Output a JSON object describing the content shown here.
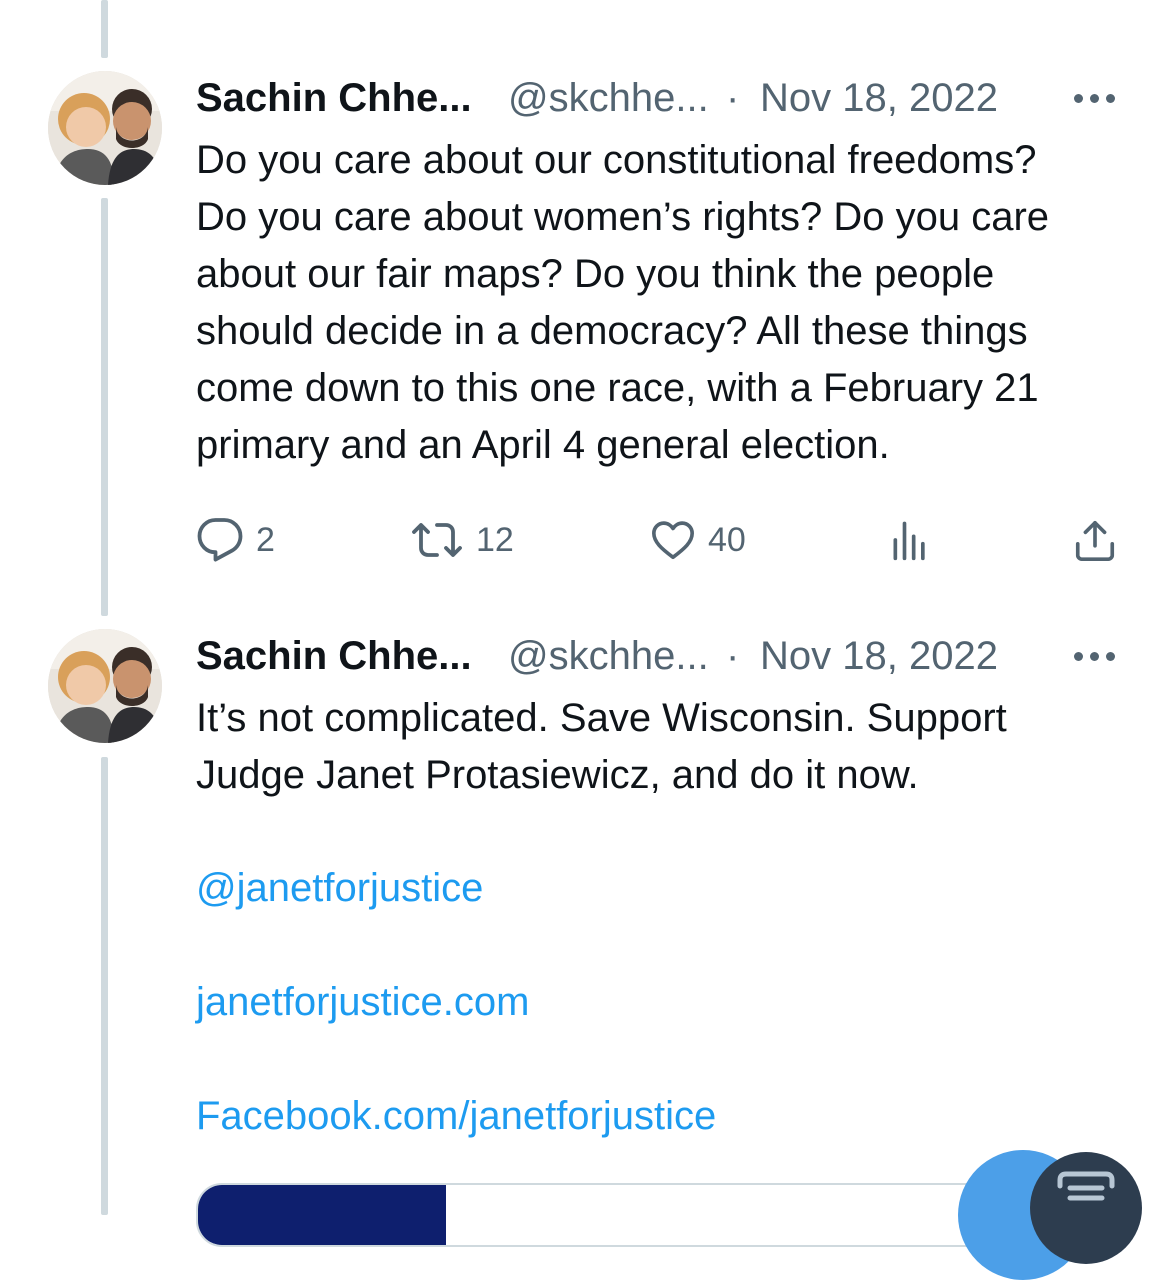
{
  "tweets": [
    {
      "author_name": "Sachin Chhe...",
      "handle": "@skchhe...",
      "separator": "·",
      "date": "Nov 18, 2022",
      "text_lines": [
        "Do you care about our constitutional freedoms?",
        "Do you care about women’s rights? Do you care",
        "about our fair maps? Do you think the people",
        "should decide in a democracy? All these things",
        "come down to this one race, with a February 21",
        "primary and an April 4 general election."
      ],
      "replies": "2",
      "retweets": "12",
      "likes": "40"
    },
    {
      "author_name": "Sachin Chhe...",
      "handle": "@skchhe...",
      "separator": "·",
      "date": "Nov 18, 2022",
      "text_lines": [
        "It’s not complicated. Save Wisconsin. Support",
        "Judge Janet Protasiewicz, and do it now."
      ],
      "links": [
        "@janetforjustice",
        "janetforjustice.com",
        "Facebook.com/janetforjustice"
      ]
    }
  ],
  "icons": {
    "reply": "reply-icon",
    "retweet": "retweet-icon",
    "like": "heart-icon",
    "views": "analytics-icon",
    "share": "share-icon",
    "more": "more-icon",
    "compose": "compose-icon"
  },
  "colors": {
    "text": "#0f1419",
    "secondary": "#536471",
    "link": "#1d9bf0",
    "thread_line": "#cfd9de"
  }
}
